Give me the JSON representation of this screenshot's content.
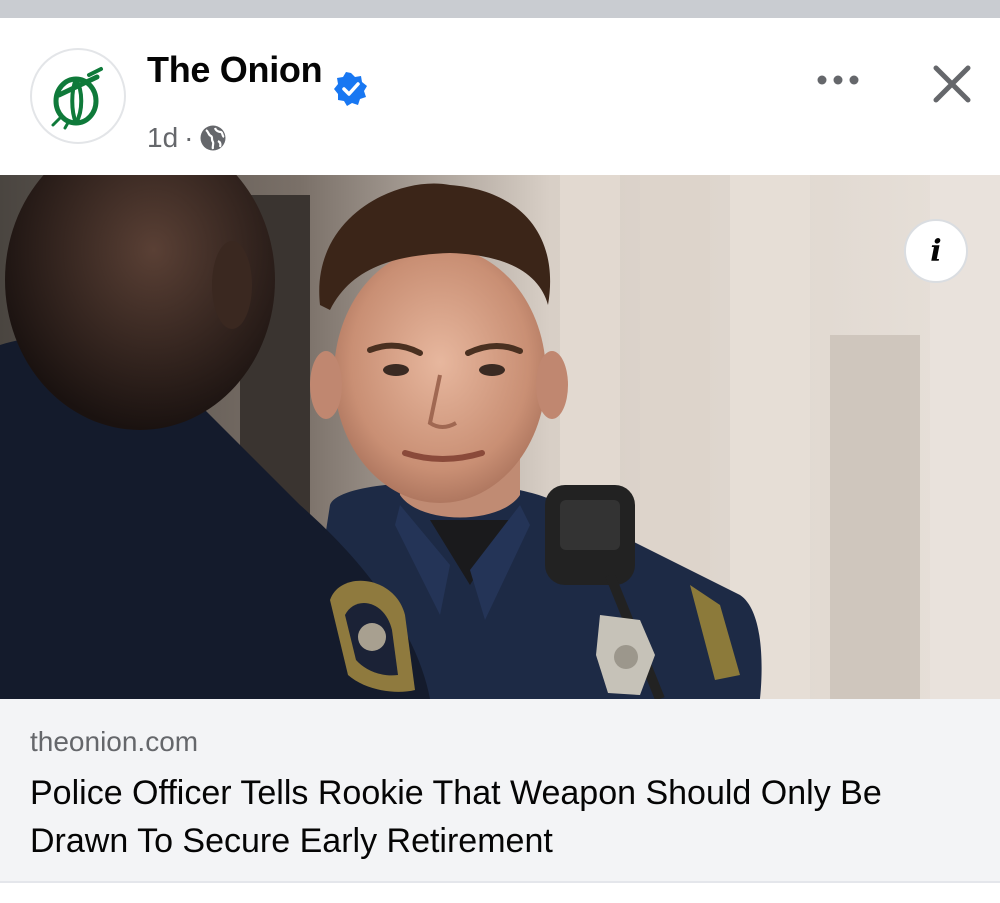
{
  "post": {
    "page_name": "The Onion",
    "verified_icon": "verified-badge-icon",
    "timestamp": "1d",
    "separator": "·",
    "audience_icon": "globe-icon",
    "more_icon": "more-options-icon",
    "close_icon": "close-icon"
  },
  "media": {
    "info_label": "i"
  },
  "link_card": {
    "domain": "theonion.com",
    "headline": "Police Officer Tells Rookie That Weapon Should Only Be Drawn To Secure Early Retirement"
  },
  "colors": {
    "verified_blue": "#1877f2",
    "onion_green": "#0f7a3a",
    "card_bg": "#f3f4f6",
    "secondary_text": "#65676b"
  }
}
